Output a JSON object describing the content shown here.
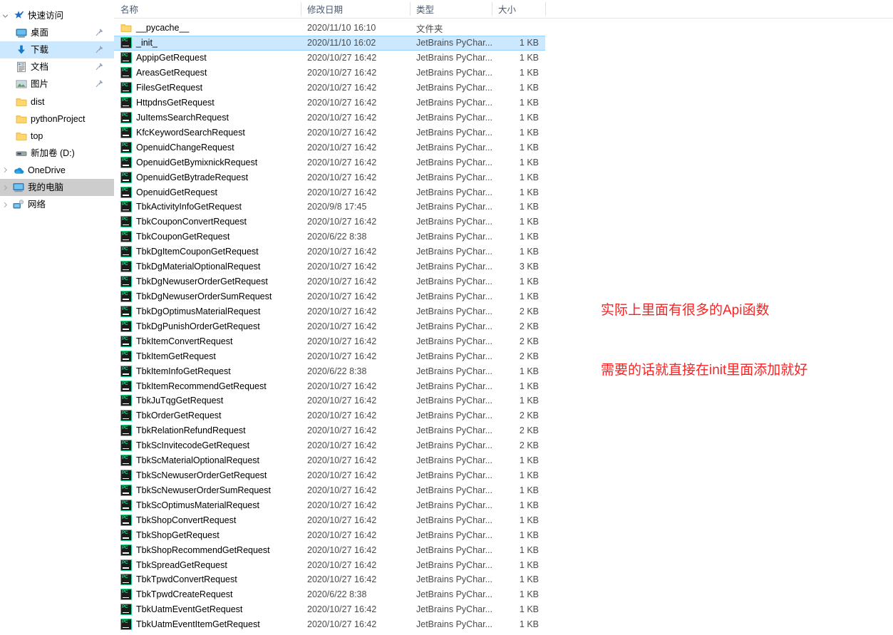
{
  "sidebar": {
    "items": [
      {
        "label": "快速访问",
        "icon": "star-pin-icon",
        "indent": 0,
        "chevron": "open",
        "pin": false,
        "state": "normal"
      },
      {
        "label": "桌面",
        "icon": "desktop-icon",
        "indent": 1,
        "chevron": "none",
        "pin": true,
        "state": "normal"
      },
      {
        "label": "下载",
        "icon": "download-icon",
        "indent": 1,
        "chevron": "none",
        "pin": true,
        "state": "selected"
      },
      {
        "label": "文档",
        "icon": "documents-icon",
        "indent": 1,
        "chevron": "none",
        "pin": true,
        "state": "normal"
      },
      {
        "label": "图片",
        "icon": "pictures-icon",
        "indent": 1,
        "chevron": "none",
        "pin": true,
        "state": "normal"
      },
      {
        "label": "dist",
        "icon": "folder-icon",
        "indent": 1,
        "chevron": "none",
        "pin": false,
        "state": "normal"
      },
      {
        "label": "pythonProject",
        "icon": "folder-icon",
        "indent": 1,
        "chevron": "none",
        "pin": false,
        "state": "normal"
      },
      {
        "label": "top",
        "icon": "folder-icon",
        "indent": 1,
        "chevron": "none",
        "pin": false,
        "state": "normal"
      },
      {
        "label": "新加卷 (D:)",
        "icon": "drive-icon",
        "indent": 1,
        "chevron": "none",
        "pin": false,
        "state": "normal"
      },
      {
        "label": "OneDrive",
        "icon": "onedrive-icon",
        "indent": 0,
        "chevron": "closed",
        "pin": false,
        "state": "normal"
      },
      {
        "label": "我的电脑",
        "icon": "this-pc-icon",
        "indent": 0,
        "chevron": "closed",
        "pin": false,
        "state": "selected-unfocused"
      },
      {
        "label": "网络",
        "icon": "network-icon",
        "indent": 0,
        "chevron": "closed",
        "pin": false,
        "state": "normal"
      }
    ]
  },
  "file_list": {
    "columns": [
      "名称",
      "修改日期",
      "类型",
      "大小"
    ],
    "rows": [
      {
        "name": "__pycache__",
        "date": "2020/11/10 16:10",
        "type": "文件夹",
        "size": "",
        "icon": "folder-icon",
        "selected": false
      },
      {
        "name": "_init_",
        "date": "2020/11/10 16:02",
        "type": "JetBrains PyChar...",
        "size": "1 KB",
        "icon": "pycharm-file-icon",
        "selected": true
      },
      {
        "name": "AppipGetRequest",
        "date": "2020/10/27 16:42",
        "type": "JetBrains PyChar...",
        "size": "1 KB",
        "icon": "pycharm-file-icon",
        "selected": false
      },
      {
        "name": "AreasGetRequest",
        "date": "2020/10/27 16:42",
        "type": "JetBrains PyChar...",
        "size": "1 KB",
        "icon": "pycharm-file-icon",
        "selected": false
      },
      {
        "name": "FilesGetRequest",
        "date": "2020/10/27 16:42",
        "type": "JetBrains PyChar...",
        "size": "1 KB",
        "icon": "pycharm-file-icon",
        "selected": false
      },
      {
        "name": "HttpdnsGetRequest",
        "date": "2020/10/27 16:42",
        "type": "JetBrains PyChar...",
        "size": "1 KB",
        "icon": "pycharm-file-icon",
        "selected": false
      },
      {
        "name": "JuItemsSearchRequest",
        "date": "2020/10/27 16:42",
        "type": "JetBrains PyChar...",
        "size": "1 KB",
        "icon": "pycharm-file-icon",
        "selected": false
      },
      {
        "name": "KfcKeywordSearchRequest",
        "date": "2020/10/27 16:42",
        "type": "JetBrains PyChar...",
        "size": "1 KB",
        "icon": "pycharm-file-icon",
        "selected": false
      },
      {
        "name": "OpenuidChangeRequest",
        "date": "2020/10/27 16:42",
        "type": "JetBrains PyChar...",
        "size": "1 KB",
        "icon": "pycharm-file-icon",
        "selected": false
      },
      {
        "name": "OpenuidGetBymixnickRequest",
        "date": "2020/10/27 16:42",
        "type": "JetBrains PyChar...",
        "size": "1 KB",
        "icon": "pycharm-file-icon",
        "selected": false
      },
      {
        "name": "OpenuidGetBytradeRequest",
        "date": "2020/10/27 16:42",
        "type": "JetBrains PyChar...",
        "size": "1 KB",
        "icon": "pycharm-file-icon",
        "selected": false
      },
      {
        "name": "OpenuidGetRequest",
        "date": "2020/10/27 16:42",
        "type": "JetBrains PyChar...",
        "size": "1 KB",
        "icon": "pycharm-file-icon",
        "selected": false
      },
      {
        "name": "TbkActivityInfoGetRequest",
        "date": "2020/9/8 17:45",
        "type": "JetBrains PyChar...",
        "size": "1 KB",
        "icon": "pycharm-file-icon",
        "selected": false
      },
      {
        "name": "TbkCouponConvertRequest",
        "date": "2020/10/27 16:42",
        "type": "JetBrains PyChar...",
        "size": "1 KB",
        "icon": "pycharm-file-icon",
        "selected": false
      },
      {
        "name": "TbkCouponGetRequest",
        "date": "2020/6/22 8:38",
        "type": "JetBrains PyChar...",
        "size": "1 KB",
        "icon": "pycharm-file-icon",
        "selected": false
      },
      {
        "name": "TbkDgItemCouponGetRequest",
        "date": "2020/10/27 16:42",
        "type": "JetBrains PyChar...",
        "size": "1 KB",
        "icon": "pycharm-file-icon",
        "selected": false
      },
      {
        "name": "TbkDgMaterialOptionalRequest",
        "date": "2020/10/27 16:42",
        "type": "JetBrains PyChar...",
        "size": "3 KB",
        "icon": "pycharm-file-icon",
        "selected": false
      },
      {
        "name": "TbkDgNewuserOrderGetRequest",
        "date": "2020/10/27 16:42",
        "type": "JetBrains PyChar...",
        "size": "1 KB",
        "icon": "pycharm-file-icon",
        "selected": false
      },
      {
        "name": "TbkDgNewuserOrderSumRequest",
        "date": "2020/10/27 16:42",
        "type": "JetBrains PyChar...",
        "size": "1 KB",
        "icon": "pycharm-file-icon",
        "selected": false
      },
      {
        "name": "TbkDgOptimusMaterialRequest",
        "date": "2020/10/27 16:42",
        "type": "JetBrains PyChar...",
        "size": "2 KB",
        "icon": "pycharm-file-icon",
        "selected": false
      },
      {
        "name": "TbkDgPunishOrderGetRequest",
        "date": "2020/10/27 16:42",
        "type": "JetBrains PyChar...",
        "size": "2 KB",
        "icon": "pycharm-file-icon",
        "selected": false
      },
      {
        "name": "TbkItemConvertRequest",
        "date": "2020/10/27 16:42",
        "type": "JetBrains PyChar...",
        "size": "2 KB",
        "icon": "pycharm-file-icon",
        "selected": false
      },
      {
        "name": "TbkItemGetRequest",
        "date": "2020/10/27 16:42",
        "type": "JetBrains PyChar...",
        "size": "2 KB",
        "icon": "pycharm-file-icon",
        "selected": false
      },
      {
        "name": "TbkItemInfoGetRequest",
        "date": "2020/6/22 8:38",
        "type": "JetBrains PyChar...",
        "size": "1 KB",
        "icon": "pycharm-file-icon",
        "selected": false
      },
      {
        "name": "TbkItemRecommendGetRequest",
        "date": "2020/10/27 16:42",
        "type": "JetBrains PyChar...",
        "size": "1 KB",
        "icon": "pycharm-file-icon",
        "selected": false
      },
      {
        "name": "TbkJuTqgGetRequest",
        "date": "2020/10/27 16:42",
        "type": "JetBrains PyChar...",
        "size": "1 KB",
        "icon": "pycharm-file-icon",
        "selected": false
      },
      {
        "name": "TbkOrderGetRequest",
        "date": "2020/10/27 16:42",
        "type": "JetBrains PyChar...",
        "size": "2 KB",
        "icon": "pycharm-file-icon",
        "selected": false
      },
      {
        "name": "TbkRelationRefundRequest",
        "date": "2020/10/27 16:42",
        "type": "JetBrains PyChar...",
        "size": "2 KB",
        "icon": "pycharm-file-icon",
        "selected": false
      },
      {
        "name": "TbkScInvitecodeGetRequest",
        "date": "2020/10/27 16:42",
        "type": "JetBrains PyChar...",
        "size": "2 KB",
        "icon": "pycharm-file-icon",
        "selected": false
      },
      {
        "name": "TbkScMaterialOptionalRequest",
        "date": "2020/10/27 16:42",
        "type": "JetBrains PyChar...",
        "size": "1 KB",
        "icon": "pycharm-file-icon",
        "selected": false
      },
      {
        "name": "TbkScNewuserOrderGetRequest",
        "date": "2020/10/27 16:42",
        "type": "JetBrains PyChar...",
        "size": "1 KB",
        "icon": "pycharm-file-icon",
        "selected": false
      },
      {
        "name": "TbkScNewuserOrderSumRequest",
        "date": "2020/10/27 16:42",
        "type": "JetBrains PyChar...",
        "size": "1 KB",
        "icon": "pycharm-file-icon",
        "selected": false
      },
      {
        "name": "TbkScOptimusMaterialRequest",
        "date": "2020/10/27 16:42",
        "type": "JetBrains PyChar...",
        "size": "1 KB",
        "icon": "pycharm-file-icon",
        "selected": false
      },
      {
        "name": "TbkShopConvertRequest",
        "date": "2020/10/27 16:42",
        "type": "JetBrains PyChar...",
        "size": "1 KB",
        "icon": "pycharm-file-icon",
        "selected": false
      },
      {
        "name": "TbkShopGetRequest",
        "date": "2020/10/27 16:42",
        "type": "JetBrains PyChar...",
        "size": "1 KB",
        "icon": "pycharm-file-icon",
        "selected": false
      },
      {
        "name": "TbkShopRecommendGetRequest",
        "date": "2020/10/27 16:42",
        "type": "JetBrains PyChar...",
        "size": "1 KB",
        "icon": "pycharm-file-icon",
        "selected": false
      },
      {
        "name": "TbkSpreadGetRequest",
        "date": "2020/10/27 16:42",
        "type": "JetBrains PyChar...",
        "size": "1 KB",
        "icon": "pycharm-file-icon",
        "selected": false
      },
      {
        "name": "TbkTpwdConvertRequest",
        "date": "2020/10/27 16:42",
        "type": "JetBrains PyChar...",
        "size": "1 KB",
        "icon": "pycharm-file-icon",
        "selected": false
      },
      {
        "name": "TbkTpwdCreateRequest",
        "date": "2020/6/22 8:38",
        "type": "JetBrains PyChar...",
        "size": "1 KB",
        "icon": "pycharm-file-icon",
        "selected": false
      },
      {
        "name": "TbkUatmEventGetRequest",
        "date": "2020/10/27 16:42",
        "type": "JetBrains PyChar...",
        "size": "1 KB",
        "icon": "pycharm-file-icon",
        "selected": false
      },
      {
        "name": "TbkUatmEventItemGetRequest",
        "date": "2020/10/27 16:42",
        "type": "JetBrains PyChar...",
        "size": "1 KB",
        "icon": "pycharm-file-icon",
        "selected": false
      }
    ]
  },
  "annotation": {
    "color": "#fb2222",
    "line1": "实际上里面有很多的Api函数",
    "line2": "需要的话就直接在init里面添加就好"
  }
}
